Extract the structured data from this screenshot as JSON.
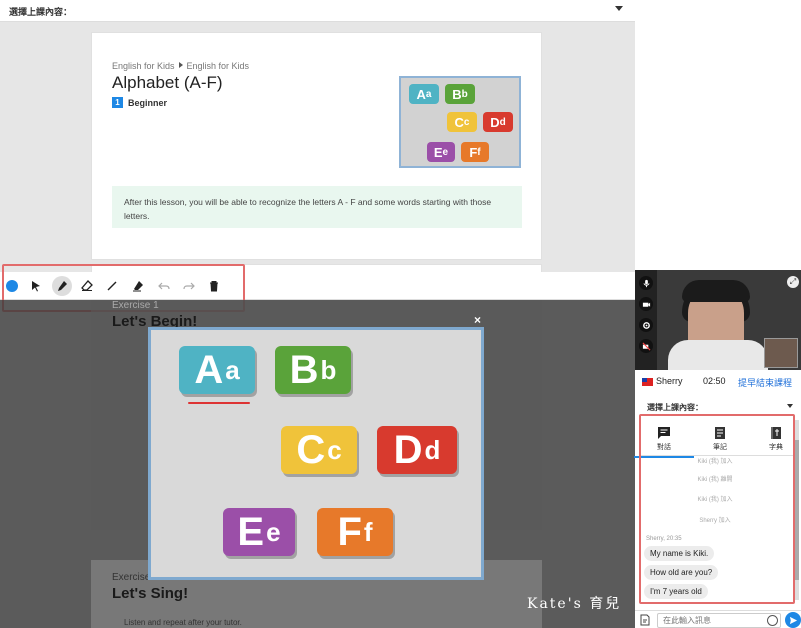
{
  "topbar": {
    "select_label": "選擇上課內容："
  },
  "lesson": {
    "breadcrumb": [
      "English for Kids",
      "English for Kids"
    ],
    "title": "Alphabet (A-F)",
    "level_number": "1",
    "level_label": "Beginner",
    "objective": "After this lesson, you will be able to recognize the letters A - F and some words starting with those letters."
  },
  "thumbnail_letters": [
    {
      "big": "A",
      "small": "a",
      "color": "#4fb3c4"
    },
    {
      "big": "B",
      "small": "b",
      "color": "#5aa33a"
    },
    {
      "big": "C",
      "small": "c",
      "color": "#f0c33a"
    },
    {
      "big": "D",
      "small": "d",
      "color": "#d83a2e"
    },
    {
      "big": "E",
      "small": "e",
      "color": "#9b4fa8"
    },
    {
      "big": "F",
      "small": "f",
      "color": "#e7792a"
    }
  ],
  "toolbar": {
    "color_dot": "#1e88e5",
    "tools": [
      "select-icon",
      "marker-icon",
      "eraser-icon",
      "line-icon",
      "highlighter-icon",
      "undo-icon",
      "redo-icon",
      "trash-icon"
    ]
  },
  "exercises": [
    {
      "label": "Exercise 1",
      "title": "Let's Begin!"
    },
    {
      "label": "Exercise",
      "title": "Let's Sing!",
      "instruction": "Listen and repeat after your tutor."
    }
  ],
  "modal": {
    "close": "×"
  },
  "tutor": {
    "name": "Sherry",
    "timer": "02:50",
    "end_label": "提早結束課程"
  },
  "right_select_label": "選擇上課內容：",
  "tabs": [
    {
      "label": "對話",
      "icon": "chat-icon"
    },
    {
      "label": "筆記",
      "icon": "notes-icon"
    },
    {
      "label": "字典",
      "icon": "dictionary-icon"
    }
  ],
  "chat": {
    "system": [
      "Kiki (我) 加入",
      "Kiki (我) 離開",
      "Kiki (我) 加入",
      "Sherry 加入"
    ],
    "meta": "Sherry, 20:35",
    "messages": [
      "My name is Kiki.",
      "How old are you?",
      "I'm 7 years old"
    ],
    "input_placeholder": "在此輸入訊息"
  },
  "watermark": "Kate's 育兒"
}
